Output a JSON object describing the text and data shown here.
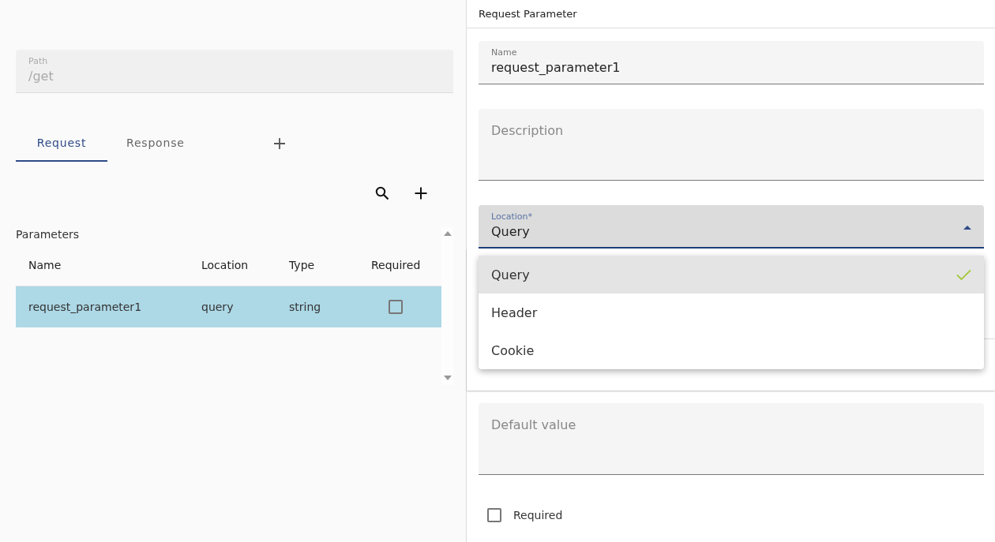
{
  "left_panel": {
    "path_field": {
      "label": "Path",
      "value": "/get",
      "disabled": true
    },
    "tabs": [
      {
        "label": "Request",
        "selected": true
      },
      {
        "label": "Response",
        "selected": false
      }
    ],
    "parameters": {
      "title": "Parameters",
      "columns": [
        "Name",
        "Location",
        "Type",
        "Required"
      ],
      "rows": [
        {
          "name": "request_parameter1",
          "location": "query",
          "type": "string",
          "required": false,
          "selected": true
        }
      ]
    }
  },
  "detail_panel": {
    "title": "Request Parameter",
    "name_field": {
      "label": "Name",
      "value": "request_parameter1"
    },
    "description_field": {
      "placeholder": "Description"
    },
    "location_field": {
      "label": "Location*",
      "value": "Query",
      "expanded": true,
      "options": [
        {
          "label": "Query",
          "selected": true
        },
        {
          "label": "Header",
          "selected": false
        },
        {
          "label": "Cookie",
          "selected": false
        }
      ]
    },
    "default_value_field": {
      "placeholder": "Default value"
    },
    "required_checkbox": {
      "label": "Required",
      "checked": false
    }
  }
}
